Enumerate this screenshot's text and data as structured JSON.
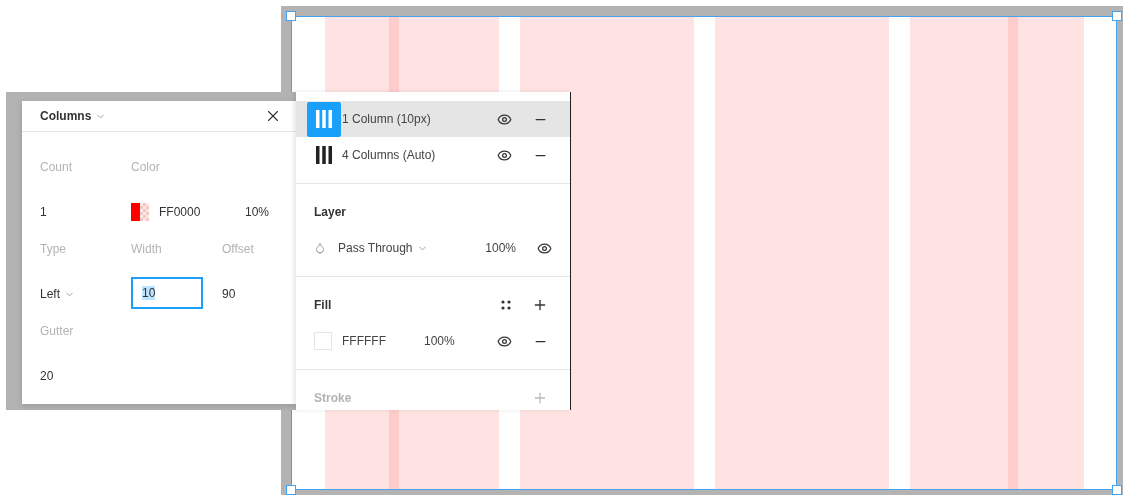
{
  "grid_settings": {
    "title": "Columns",
    "fields": [
      {
        "label": "Count",
        "value": "1"
      },
      {
        "label": "Color",
        "kind": "color",
        "value": "FF0000",
        "opacity": "10%",
        "color": "#ff0000"
      },
      {
        "label": "Type",
        "kind": "dropdown",
        "value": "Left"
      },
      {
        "label": "Width",
        "kind": "input",
        "value": "10",
        "focused": true
      },
      {
        "label": "Offset",
        "value": "90"
      },
      {
        "label": "Gutter",
        "value": "20"
      }
    ]
  },
  "layout_grids": [
    {
      "label": "1 Column (10px)",
      "selected": true
    },
    {
      "label": "4 Columns (Auto)",
      "selected": false
    }
  ],
  "layer": {
    "title": "Layer",
    "blend_mode": "Pass Through",
    "opacity": "100%"
  },
  "fill": {
    "title": "Fill",
    "items": [
      {
        "hex": "FFFFFF",
        "opacity": "100%",
        "color": "#ffffff"
      }
    ]
  },
  "stroke": {
    "title": "Stroke"
  }
}
